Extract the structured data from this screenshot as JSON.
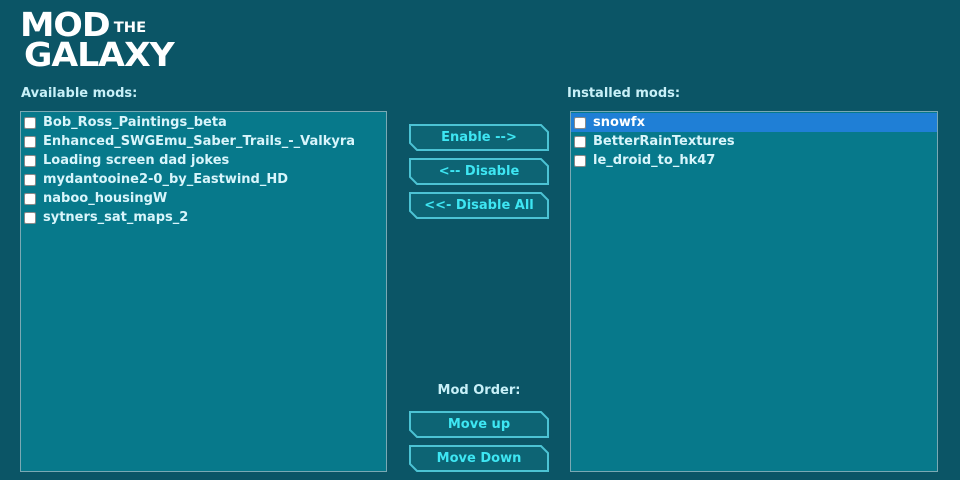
{
  "logo": {
    "line1": "MOD",
    "line1_small": "THE",
    "line2": "GALAXY"
  },
  "available": {
    "label": "Available mods:",
    "items": [
      "Bob_Ross_Paintings_beta",
      "Enhanced_SWGEmu_Saber_Trails_-_Valkyra",
      "Loading screen dad jokes",
      "mydantooine2-0_by_Eastwind_HD",
      "naboo_housingW",
      "sytners_sat_maps_2"
    ]
  },
  "installed": {
    "label": "Installed mods:",
    "items": [
      "snowfx",
      "BetterRainTextures",
      "le_droid_to_hk47"
    ],
    "selected_index": 0
  },
  "buttons": {
    "enable": "Enable -->",
    "disable": "<-- Disable",
    "disable_all": "<<- Disable All",
    "mod_order_label": "Mod Order:",
    "move_up": "Move up",
    "move_down": "Move Down"
  },
  "colors": {
    "background": "#0b5566",
    "list_background": "#07798b",
    "selection": "#1f7fd6",
    "button_text": "#3ee6f3",
    "button_border": "#4cc3d4"
  }
}
